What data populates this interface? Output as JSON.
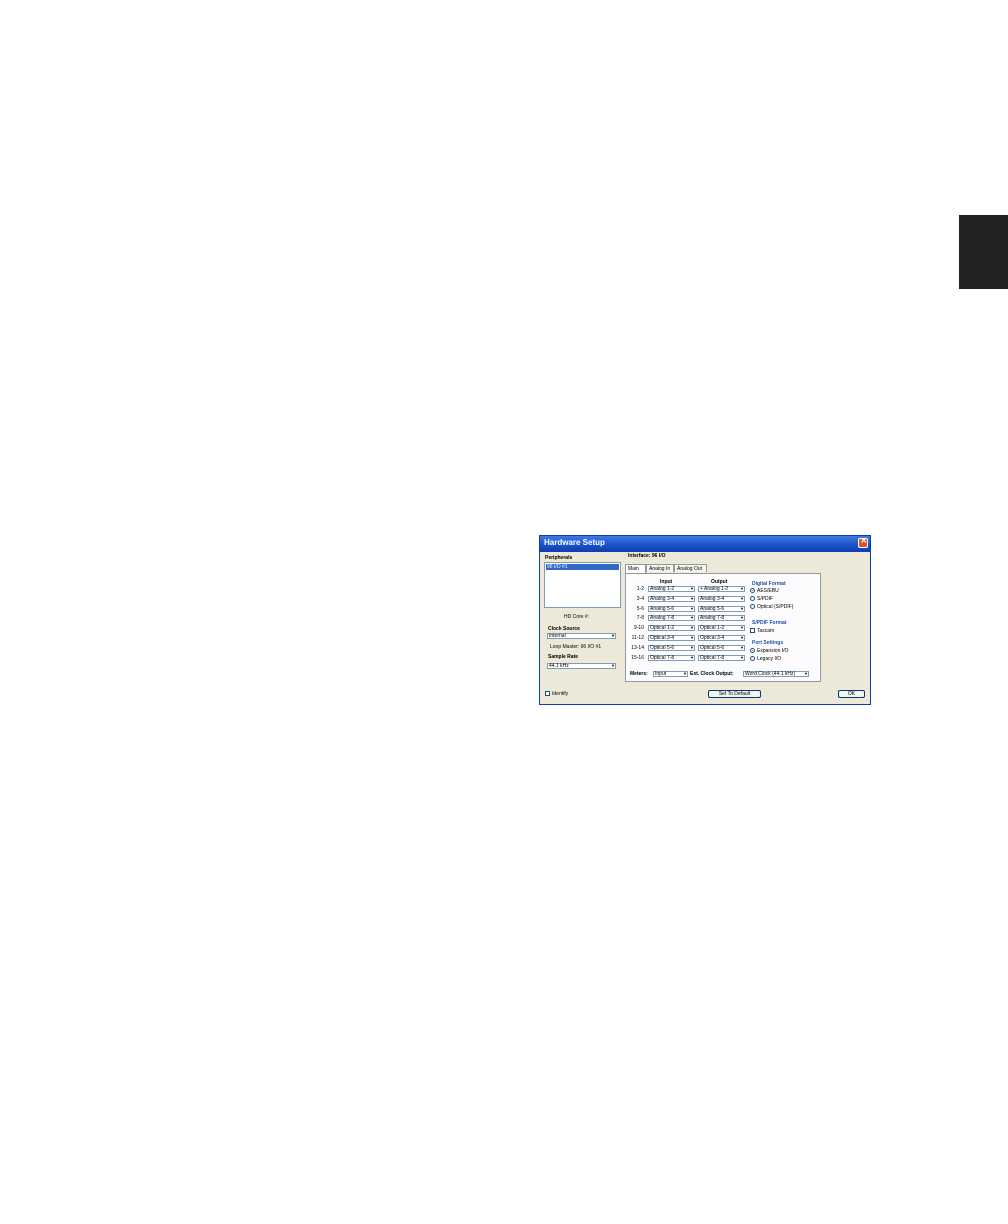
{
  "window": {
    "title": "Hardware Setup",
    "close_glyph": "×"
  },
  "peripherals": {
    "label": "Peripherals",
    "items": [
      "96 I/O #1"
    ],
    "selected": "96 I/O #1"
  },
  "hd_core_label": "HD Core #:",
  "clock_source": {
    "label": "Clock Source",
    "value": "Internal",
    "loop_master": "Loop Master: 96 I/O #1"
  },
  "sample_rate": {
    "label": "Sample Rate",
    "value": "44.1 kHz"
  },
  "identify_label": "Identify",
  "interface_label": "Interface: 96 I/O",
  "tabs": [
    "Main",
    "Analog In",
    "Analog Out"
  ],
  "active_tab": "Main",
  "columns": {
    "input": "Input",
    "output": "Output"
  },
  "routing": [
    {
      "ch": "1-2",
      "input": "Analog 1-2",
      "output": "+ Analog 1-2"
    },
    {
      "ch": "3-4",
      "input": "Analog 3-4",
      "output": "Analog 3-4"
    },
    {
      "ch": "5-6",
      "input": "Analog 5-6",
      "output": "Analog 5-6"
    },
    {
      "ch": "7-8",
      "input": "Analog 7-8",
      "output": "Analog 7-8"
    },
    {
      "ch": "9-10",
      "input": "Optical 1-2",
      "output": "Optical 1-2"
    },
    {
      "ch": "11-12",
      "input": "Optical 3-4",
      "output": "Optical 3-4"
    },
    {
      "ch": "13-14",
      "input": "Optical 5-6",
      "output": "Optical 5-6"
    },
    {
      "ch": "15-16",
      "input": "Optical 7-8",
      "output": "Optical 7-8"
    }
  ],
  "digital_format": {
    "label": "Digital Format",
    "options": [
      "AES/EBU",
      "S/PDIF",
      "Optical (S/PDIF)"
    ],
    "selected": "AES/EBU"
  },
  "spdif_format": {
    "label": "S/PDIF Format",
    "tascam_label": "Tascam",
    "tascam_checked": false
  },
  "port_settings": {
    "label": "Port Settings",
    "options": [
      "Expansion I/O",
      "Legacy I/O"
    ],
    "selected": "Expansion I/O"
  },
  "meters": {
    "label": "Meters:",
    "value": "Input"
  },
  "ext_clock": {
    "label": "Ext. Clock Output:",
    "value": "Word Clock (44.1 kHz)"
  },
  "buttons": {
    "set_default": "Set To Default",
    "ok": "OK"
  },
  "colors": {
    "title_bar": "#1850c8",
    "dialog_bg": "#ece9d8",
    "section_title": "#1f4ea8",
    "side_tab": "#222222"
  }
}
